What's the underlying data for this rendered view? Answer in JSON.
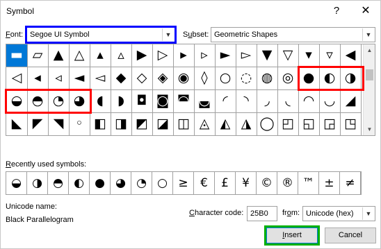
{
  "window": {
    "title": "Symbol",
    "help": "?",
    "close": "✕"
  },
  "font": {
    "label_u": "F",
    "label_rest": "ont:",
    "value": "Segoe UI Symbol"
  },
  "subset": {
    "label_pre": "S",
    "label_u": "u",
    "label_rest": "bset:",
    "value": "Geometric Shapes"
  },
  "grid": {
    "rows": [
      [
        "▬",
        "▱",
        "▲",
        "△",
        "▴",
        "▵",
        "▶",
        "▷",
        "▸",
        "▹",
        "►",
        "▻",
        "▼",
        "▽",
        "▾",
        "▿",
        "◀"
      ],
      [
        "◁",
        "◂",
        "◃",
        "◄",
        "◅",
        "◆",
        "◇",
        "◈",
        "◉",
        "◊",
        "○",
        "◌",
        "◍",
        "◎",
        "●",
        "◐",
        "◑"
      ],
      [
        "◒",
        "◓",
        "◔",
        "◕",
        "◖",
        "◗",
        "◘",
        "◙",
        "◚",
        "◛",
        "◜",
        "◝",
        "◞",
        "◟",
        "◠",
        "◡",
        "◢"
      ],
      [
        "◣",
        "◤",
        "◥",
        "◦",
        "◧",
        "◨",
        "◩",
        "◪",
        "◫",
        "◬",
        "◭",
        "◮",
        "◯",
        "◰",
        "◱",
        "◲",
        "◳"
      ]
    ],
    "selected": "▬"
  },
  "recent": {
    "label_u": "R",
    "label_rest": "ecently used symbols:",
    "items": [
      "◒",
      "◑",
      "◓",
      "◐",
      "●",
      "◕",
      "◔",
      "○",
      "≥",
      "€",
      "£",
      "¥",
      "©",
      "®",
      "™",
      "±",
      "≠"
    ]
  },
  "unicode": {
    "label": "Unicode name:",
    "name": "Black Parallelogram"
  },
  "charcode": {
    "label_u": "C",
    "label_rest": "haracter code:",
    "value": "25B0"
  },
  "from": {
    "label_pre": "fr",
    "label_u": "o",
    "label_rest": "m:",
    "value": "Unicode (hex)"
  },
  "buttons": {
    "insert_u": "I",
    "insert_rest": "nsert",
    "cancel": "Cancel"
  },
  "colors": {
    "accent": "#0078d7",
    "highlight_blue": "#0000ff",
    "highlight_red": "#ff0000",
    "highlight_green": "#00b000"
  }
}
